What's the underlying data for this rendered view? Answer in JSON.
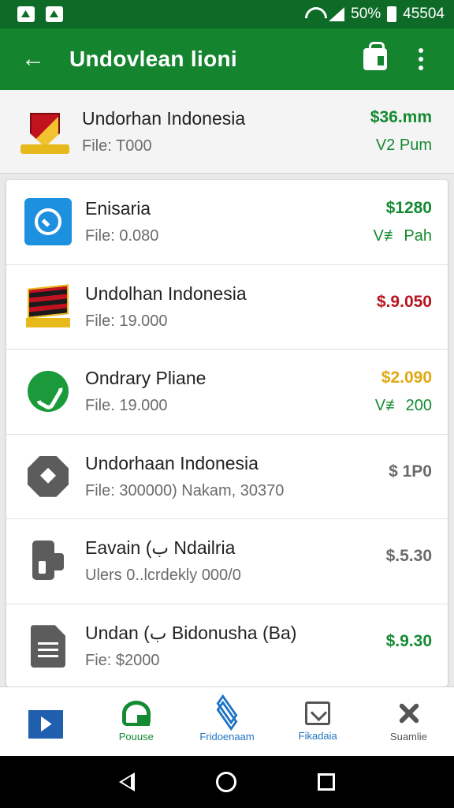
{
  "status_bar": {
    "battery": "50%",
    "time": "45504"
  },
  "app_bar": {
    "title": "Undovlean lioni"
  },
  "featured": {
    "title": "Undorhan Indonesia",
    "subtitle": "File: T000",
    "price": "$36.mm",
    "tag": "V2 Pum",
    "icon": "crest-icon"
  },
  "items": [
    {
      "title": "Enisaria",
      "subtitle": "File: 0.080",
      "price": "$1280",
      "tag": "V≢ Pah",
      "icon": "phone-icon",
      "price_color": "#148a32"
    },
    {
      "title": "Undolhan Indonesia",
      "subtitle": "File: 19.000",
      "price": "$.9.050",
      "tag": "",
      "icon": "flag-icon",
      "price_color": "#b8141f"
    },
    {
      "title": "Ondrary Pliane",
      "subtitle": "File. 19.000",
      "price": "$2.090",
      "tag": "V≢ 200",
      "icon": "whatsapp-icon",
      "price_color": "#e0a811"
    },
    {
      "title": "Undorhaan Indonesia",
      "subtitle": "File: 300000) Nakam, 30370",
      "price": "$ 1P0",
      "tag": "",
      "icon": "octagon-icon",
      "price_color": "#6a6a6a"
    },
    {
      "title": "Eavain (ب Ndailria",
      "subtitle": "Ulers 0..lcrdekly 000/0",
      "price": "$.5.30",
      "tag": "",
      "icon": "wallet-icon",
      "price_color": "#6a6a6a"
    },
    {
      "title": "Undan (ب Bidonusha (Ba)",
      "subtitle": "Fie: $2000",
      "price": "$.9.30",
      "tag": "",
      "icon": "document-icon",
      "price_color": "#148a32"
    }
  ],
  "bottom_nav": [
    {
      "label": "",
      "icon": "play-icon",
      "color": "#1f5fad"
    },
    {
      "label": "Pouuse",
      "icon": "cart-icon",
      "color": "#148a32"
    },
    {
      "label": "Fridoenaam",
      "icon": "layers-icon",
      "color": "#1f74c4"
    },
    {
      "label": "Fikadaia",
      "icon": "inbox-icon",
      "color": "#1f74c4"
    },
    {
      "label": "Suamlie",
      "icon": "tools-icon",
      "color": "#555555"
    }
  ],
  "colors": {
    "primary": "#14842f",
    "status_bar": "#0e6b27"
  }
}
